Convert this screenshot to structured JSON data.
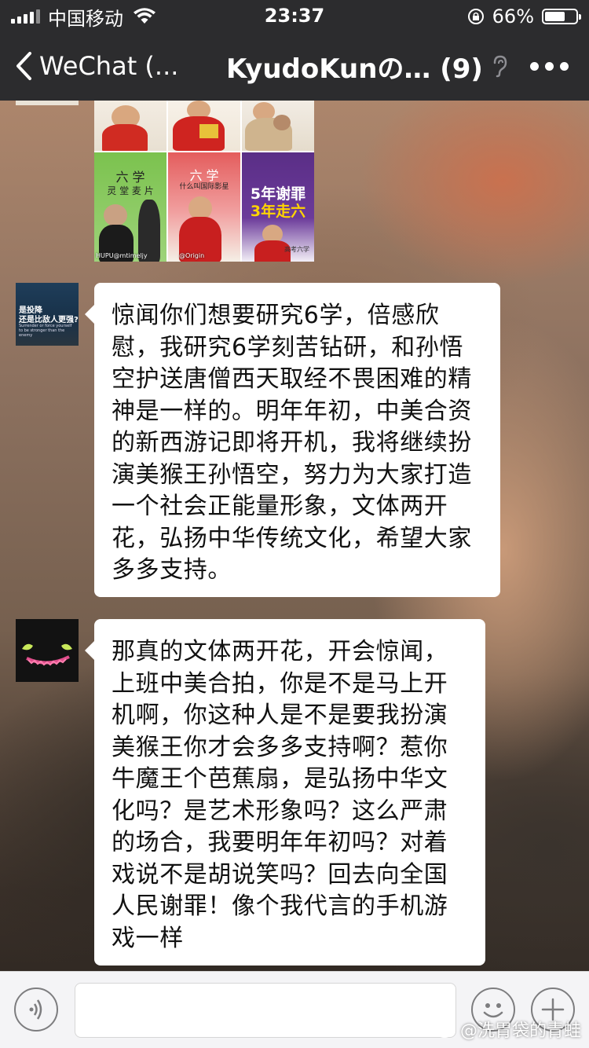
{
  "status_bar": {
    "carrier": "中国移动",
    "time": "23:37",
    "battery": "66%",
    "battery_level": 0.66
  },
  "nav": {
    "back_label": "WeChat (...",
    "title": "KyudoKunの… (9)"
  },
  "collage": {
    "book_title": "六 学",
    "book_subtitle_1": "灵 堂 麦 片",
    "book_subtitle_2": "什么叫国际影星",
    "big_title_line1": "5年谢罪",
    "big_title_line2": "3年走六",
    "small_text": "高考六学",
    "watermark_1": "HUPU@mtimeljy",
    "watermark_2": "@Origin"
  },
  "avatar_1": {
    "line1": "是投降",
    "line2": "还是比敌人更强?",
    "line3": "Surrender or force yourself to be stronger than the enemy"
  },
  "messages": [
    {
      "sender": "other",
      "text": "惊闻你们想要研究6学，倍感欣慰，我研究6学刻苦钻研，和孙悟空护送唐僧西天取经不畏困难的精神是一样的。明年年初，中美合资的新西游记即将开机，我将继续扮演美猴王孙悟空，努力为大家打造一个社会正能量形象，文体两开花，弘扬中华传统文化，希望大家多多支持。"
    },
    {
      "sender": "other",
      "text": "那真的文体两开花，开会惊闻，上班中美合拍，你是不是马上开机啊，你这种人是不是要我扮演美猴王你才会多多支持啊？惹你牛魔王个芭蕉扇，是弘扬中华文化吗？是艺术形象吗？这么严肃的场合，我要明年年初吗？对着戏说不是胡说笑吗？回去向全国人民谢罪！像个我代言的手机游戏一样"
    }
  ],
  "watermark": "@洗胃袋的青蛙",
  "icons": [
    "signal-icon",
    "wifi-icon",
    "rotation-lock-icon",
    "battery-icon",
    "back-chevron-icon",
    "ear-icon",
    "more-icon",
    "voice-icon",
    "emoji-icon",
    "plus-icon",
    "weibo-icon"
  ]
}
